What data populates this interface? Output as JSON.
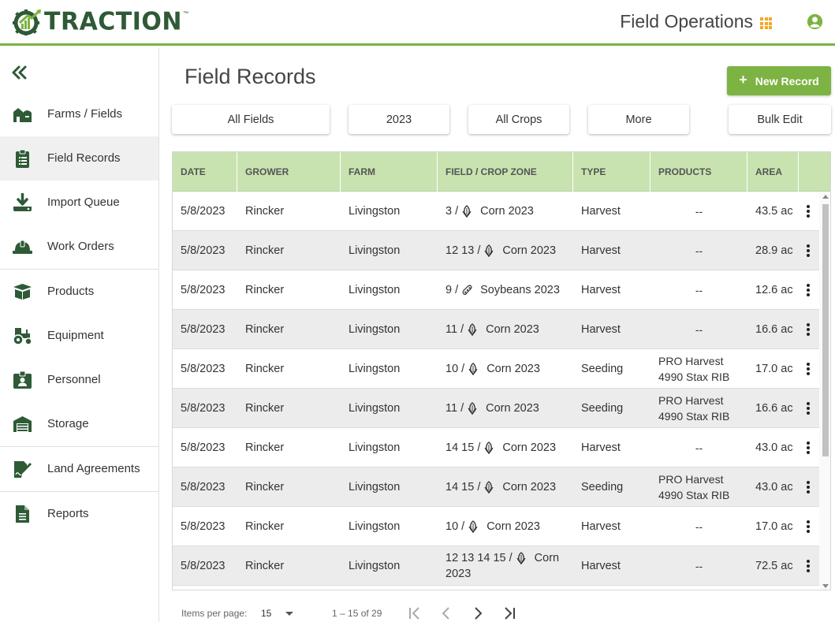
{
  "header": {
    "logo_text": "TRACTION",
    "logo_tm": "™",
    "app_title": "Field Operations"
  },
  "sidebar": {
    "items": [
      {
        "label": "Farms / Fields",
        "icon": "farm-icon"
      },
      {
        "label": "Field Records",
        "icon": "clipboard-icon"
      },
      {
        "label": "Import Queue",
        "icon": "download-icon"
      },
      {
        "label": "Work Orders",
        "icon": "hardhat-icon"
      },
      {
        "label": "Products",
        "icon": "box-icon"
      },
      {
        "label": "Equipment",
        "icon": "tractor-icon"
      },
      {
        "label": "Personnel",
        "icon": "id-badge-icon"
      },
      {
        "label": "Storage",
        "icon": "warehouse-icon"
      },
      {
        "label": "Land Agreements",
        "icon": "signature-icon"
      },
      {
        "label": "Reports",
        "icon": "document-icon"
      }
    ],
    "active_index": 1
  },
  "main": {
    "title": "Field Records",
    "new_record_label": "New Record",
    "filters": {
      "fields": "All Fields",
      "year": "2023",
      "crops": "All Crops",
      "more": "More",
      "bulk_edit": "Bulk Edit"
    }
  },
  "table": {
    "columns": [
      "DATE",
      "GROWER",
      "FARM",
      "FIELD / CROP ZONE",
      "TYPE",
      "PRODUCTS",
      "AREA"
    ],
    "rows": [
      {
        "date": "5/8/2023",
        "grower": "Rincker",
        "farm": "Livingston",
        "field": "3 /",
        "crop": "Corn 2023",
        "crop_icon": "corn-icon",
        "type": "Harvest",
        "products_1": "--",
        "products_2": "",
        "area": "43.5 ac"
      },
      {
        "date": "5/8/2023",
        "grower": "Rincker",
        "farm": "Livingston",
        "field": "12 13 /",
        "crop": "Corn 2023",
        "crop_icon": "corn-icon",
        "type": "Harvest",
        "products_1": "--",
        "products_2": "",
        "area": "28.9 ac"
      },
      {
        "date": "5/8/2023",
        "grower": "Rincker",
        "farm": "Livingston",
        "field": "9 /",
        "crop": "Soybeans 2023",
        "crop_icon": "soybean-icon",
        "type": "Harvest",
        "products_1": "--",
        "products_2": "",
        "area": "12.6 ac"
      },
      {
        "date": "5/8/2023",
        "grower": "Rincker",
        "farm": "Livingston",
        "field": "11 /",
        "crop": "Corn 2023",
        "crop_icon": "corn-icon",
        "type": "Harvest",
        "products_1": "--",
        "products_2": "",
        "area": "16.6 ac"
      },
      {
        "date": "5/8/2023",
        "grower": "Rincker",
        "farm": "Livingston",
        "field": "10 /",
        "crop": "Corn 2023",
        "crop_icon": "corn-icon",
        "type": "Seeding",
        "products_1": "PRO Harvest",
        "products_2": "4990 Stax RIB",
        "area": "17.0 ac"
      },
      {
        "date": "5/8/2023",
        "grower": "Rincker",
        "farm": "Livingston",
        "field": "11 /",
        "crop": "Corn 2023",
        "crop_icon": "corn-icon",
        "type": "Seeding",
        "products_1": "PRO Harvest",
        "products_2": "4990 Stax RIB",
        "area": "16.6 ac"
      },
      {
        "date": "5/8/2023",
        "grower": "Rincker",
        "farm": "Livingston",
        "field": "14 15 /",
        "crop": "Corn 2023",
        "crop_icon": "corn-icon",
        "type": "Harvest",
        "products_1": "--",
        "products_2": "",
        "area": "43.0 ac"
      },
      {
        "date": "5/8/2023",
        "grower": "Rincker",
        "farm": "Livingston",
        "field": "14 15 /",
        "crop": "Corn 2023",
        "crop_icon": "corn-icon",
        "type": "Seeding",
        "products_1": "PRO Harvest",
        "products_2": "4990 Stax RIB",
        "area": "43.0 ac"
      },
      {
        "date": "5/8/2023",
        "grower": "Rincker",
        "farm": "Livingston",
        "field": "10 /",
        "crop": "Corn 2023",
        "crop_icon": "corn-icon",
        "type": "Harvest",
        "products_1": "--",
        "products_2": "",
        "area": "17.0 ac"
      },
      {
        "date": "5/8/2023",
        "grower": "Rincker",
        "farm": "Livingston",
        "field": "12 13 14 15 /",
        "crop": "Corn",
        "crop_line2": "2023",
        "crop_icon": "corn-icon",
        "type": "Harvest",
        "products_1": "--",
        "products_2": "",
        "area": "72.5 ac"
      }
    ]
  },
  "paginator": {
    "items_per_page_label": "Items per page:",
    "items_per_page_value": "15",
    "range_label": "1 – 15 of 29"
  },
  "colors": {
    "accent_green": "#7cb342",
    "header_green": "#c8e3b0",
    "logo_green": "#2e5a36",
    "apps_orange": "#f5a623"
  }
}
